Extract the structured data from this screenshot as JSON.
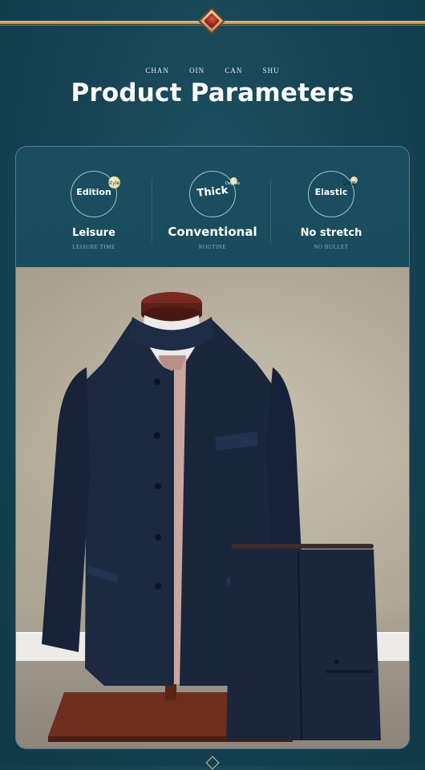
{
  "header": {
    "pinyin": [
      "CHAN",
      "OIN",
      "CAN",
      "SHU"
    ],
    "title": "Product Parameters"
  },
  "params": [
    {
      "circle_label": "Edition",
      "tag": "Style",
      "value": "Leisure",
      "sub": "LEISURE TIME"
    },
    {
      "circle_label": "Thick",
      "tag": "Degree",
      "value": "Conventional",
      "sub": "ROUTINE"
    },
    {
      "circle_label": "Elastic",
      "tag": "Sex",
      "value": "No stretch",
      "sub": "NO BULLET"
    }
  ],
  "image": {
    "subject": "suit",
    "colors": {
      "jacket": "#1c2940",
      "sweater": "#c9a79e",
      "wall": "#bcb29f",
      "stand": "#6e2f1e"
    }
  },
  "icons": [
    "diamond-ornament-icon"
  ]
}
